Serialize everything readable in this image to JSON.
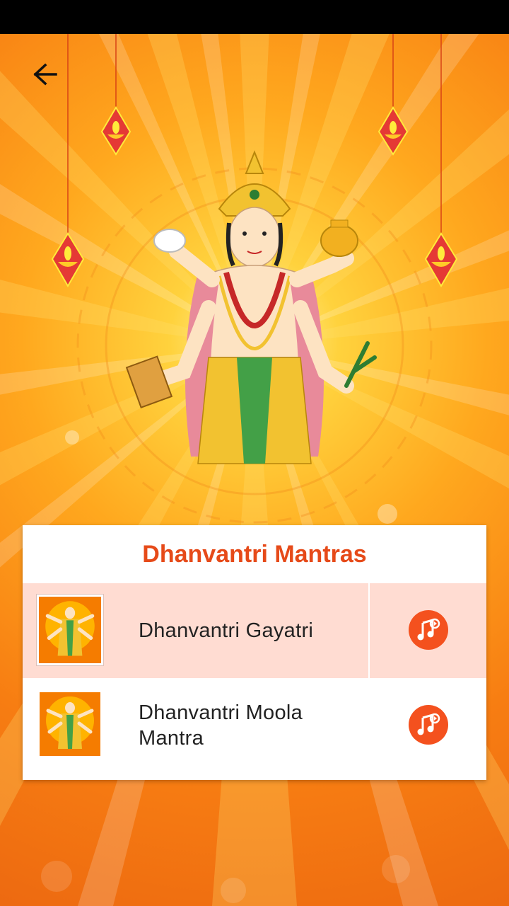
{
  "header": {
    "back_icon": "arrow-left-icon"
  },
  "colors": {
    "accent": "#e64a19",
    "play_button": "#f4511e",
    "selected_row": "#ffdcd2",
    "background_center": "#ffd23d",
    "background_edge": "#e86010"
  },
  "card": {
    "title": "Dhanvantri Mantras",
    "items": [
      {
        "label": "Dhanvantri Gayatri",
        "selected": true,
        "action_icon": "music-note-icon"
      },
      {
        "label": "Dhanvantri Moola Mantra",
        "selected": false,
        "action_icon": "music-note-icon"
      }
    ]
  }
}
